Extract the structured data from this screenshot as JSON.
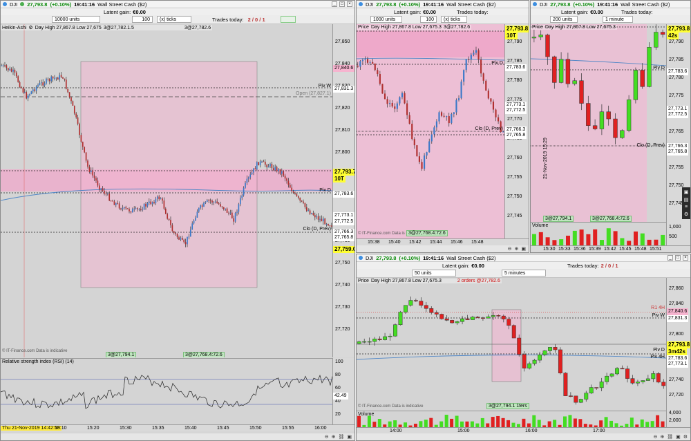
{
  "common": {
    "instrument_short": "DJI",
    "price": "27,793.8",
    "change": "(+0.10%)",
    "time": "19:41:16",
    "name": "Wall Street Cash ($2)",
    "latent_gain": "Latent gain:",
    "latent_value": "€0.00",
    "trades_today_label": "Trades today:",
    "trades_today": "2 / 0 / 1",
    "footer_note": "© IT-Finance.com  Data is indicative"
  },
  "win_main": {
    "units": "10000 units",
    "ticks_value": "100",
    "ticks_label": "(x) ticks",
    "indicator": "Heikin-Ashi",
    "info": "Day High 27,867.8 Low 27,675",
    "info2": "3@27,782.1.5",
    "info3": "3@27,782.6",
    "y_ticks": [
      "27,850",
      "27,840",
      "27,830",
      "27,820",
      "27,810",
      "27,800",
      "27,790",
      "27,780",
      "27,770",
      "27,760",
      "27,750",
      "27,740",
      "27,730",
      "27,720"
    ],
    "price_labels": {
      "p1": "27,840.6",
      "p2": "27,831.3",
      "p3": "27,827.1",
      "p4": "27,793.7",
      "p5": "10T",
      "p6": "27,783.6",
      "p7": "27,773.1",
      "p8": "27,772.5",
      "p9": "27,770",
      "p10": "27,766.3",
      "p11": "27,765.8",
      "p12": "27,759.0"
    },
    "line_labels": {
      "pivw": "Piv W",
      "open": "Open (27,827.1)",
      "pivd": "Piv D",
      "clod": "Clo (D, Prev)"
    },
    "tag1": "3@27,794.1",
    "tag2": "3@27,768.4:72.6",
    "rsi_label": "Relative strength index (RSI) (14)",
    "rsi_ticks": [
      "100",
      "80",
      "60",
      "40",
      "20"
    ],
    "rsi_value": "42.49",
    "x_ticks": [
      "15:10",
      "15:20",
      "15:30",
      "15:35",
      "15:40",
      "15:45",
      "15:50",
      "15:55",
      "16:00"
    ],
    "x_first": "Thu 21-Nov-2019 14:42:58"
  },
  "win_tm": {
    "units": "1000 units",
    "ticks_value": "100",
    "ticks_label": "(x) ticks",
    "info": "Day High 27,867.8 Low 27,675.3",
    "info2": "3@27,782.6",
    "y_ticks": [
      "27,790",
      "27,785",
      "27,780",
      "27,775",
      "27,770",
      "27,765",
      "27,760",
      "27,755",
      "27,750",
      "27,745"
    ],
    "price_labels": {
      "p1": "27,793.8",
      "p2": "10T",
      "p3": "27,783.6",
      "p4": "27,773.1",
      "p5": "27,772.5",
      "p6": "27,770",
      "p7": "27,766.3",
      "p8": "27,765.8"
    },
    "x_ticks": [
      "15:38",
      "15:40",
      "15:42",
      "15:44",
      "15:46",
      "15:48"
    ],
    "tag": "3@27,768.4:72.6",
    "pivd": "Piv D",
    "clod": "Clo (D, Prev)"
  },
  "win_tr": {
    "units": "200 units",
    "tf": "1 minute",
    "info": "Day High 27,867.8 Low 27,675.3",
    "y_ticks": [
      "27,790",
      "27,785",
      "27,780",
      "27,775",
      "27,770",
      "27,765",
      "27,760",
      "27,755",
      "27,750",
      "27,745"
    ],
    "price_labels": {
      "p1": "27,793.8",
      "p2": "42s",
      "p3": "27,783.6",
      "p4": "27,773.1",
      "p5": "27,772.5",
      "p6": "27,770",
      "p7": "27,766.3",
      "p8": "27,765.8"
    },
    "volume_label": "Volume",
    "vol_ticks": [
      "1,000",
      "500"
    ],
    "x_ticks": [
      "15:30",
      "15:33",
      "15:36",
      "15:39",
      "15:42",
      "15:45",
      "15:48",
      "15:51"
    ],
    "date_rotated": "21-Nov-2019 15:29",
    "tag1": "3@27,794.1",
    "tag2": "3@27,768.4:72.6",
    "pivd": "Piv D",
    "clod": "Clo (D, Prev)"
  },
  "win_br": {
    "units": "50 units",
    "tf": "5 minutes",
    "info": "Day High 27,867.8 Low 27,675.3",
    "orders": "2 orders @27,782.6",
    "y_ticks": [
      "27,860",
      "27,840",
      "27,820",
      "27,800",
      "27,780",
      "27,760",
      "27,740",
      "27,720"
    ],
    "price_labels": {
      "p1": "27,840.6",
      "p2": "27,831.3",
      "p3": "27,793.8",
      "p4": "3m42s",
      "p5": "27,783.6",
      "p6": "27,773.1",
      "p7": "27,765.8",
      "p8": "27,772.5"
    },
    "r1": "R1 4H",
    "pivw": "Piv W",
    "pivd": "Piv D",
    "piv4h": "Piv 4H",
    "tag": "3@27,794.1 1ters",
    "volume_label": "Volume",
    "vol_ticks": [
      "4,000",
      "2,000"
    ],
    "x_ticks": [
      "14:00",
      "15:00",
      "16:00",
      "17:00"
    ]
  }
}
